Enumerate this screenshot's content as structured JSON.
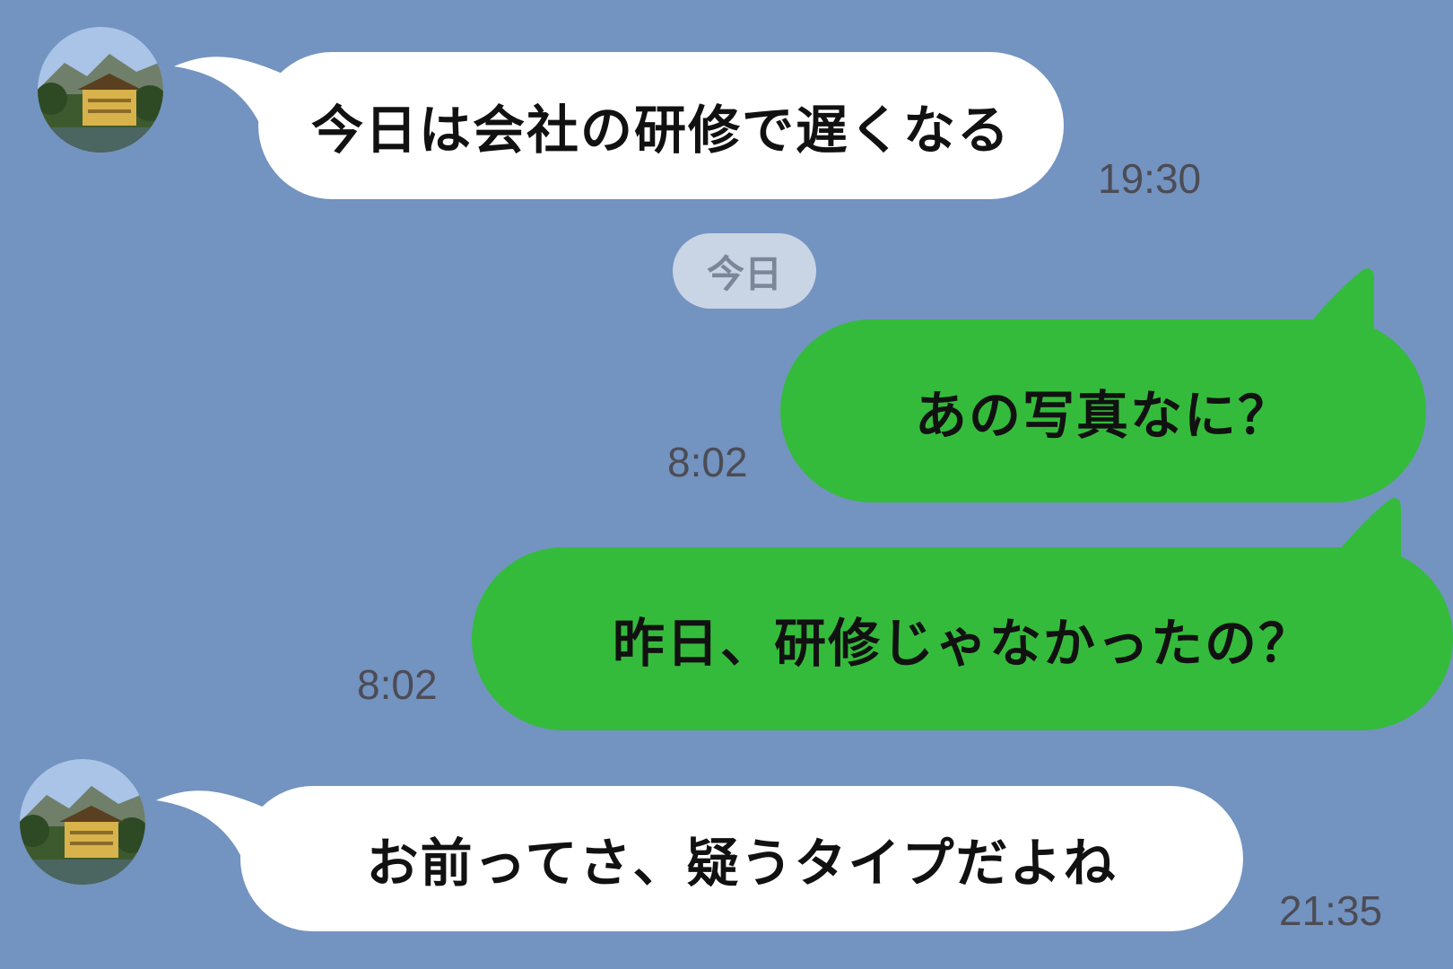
{
  "messages": [
    {
      "side": "in",
      "text": "今日は会社の研修で遅くなる",
      "time": "19:30"
    },
    {
      "side": "out",
      "text": "あの写真なに？",
      "time": "8:02"
    },
    {
      "side": "out",
      "text": "昨日、研修じゃなかったの？",
      "time": "8:02"
    },
    {
      "side": "in",
      "text": "お前ってさ、疑うタイプだよね",
      "time": "21:35"
    }
  ],
  "date_separator": "今日",
  "colors": {
    "background": "#7393c1",
    "incoming_bubble": "#ffffff",
    "outgoing_bubble": "#35bb3c",
    "date_pill": "#c9d4e4",
    "timestamp": "#4c4c55"
  },
  "avatar": {
    "icon": "golden-pavilion-photo"
  }
}
